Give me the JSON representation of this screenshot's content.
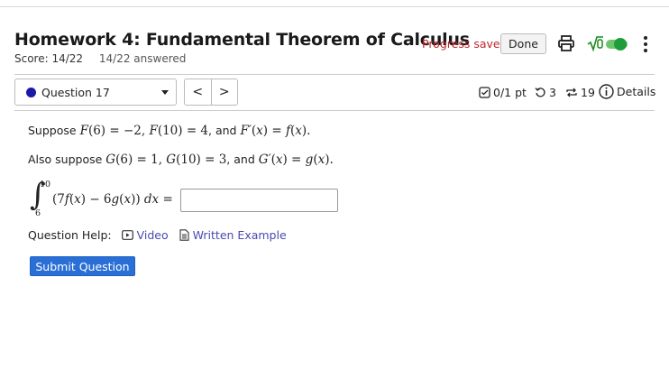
{
  "header": {
    "title": "Homework 4: Fundamental Theorem of Calculus",
    "score": "Score: 14/22",
    "answered": "14/22 answered",
    "progress_status": "Progress saved",
    "done_label": "Done"
  },
  "toolbar": {
    "question_select": "Question 17",
    "prev": "<",
    "next": ">",
    "points": "0/1 pt",
    "retries": "3",
    "attempts": "19",
    "details": "Details"
  },
  "problem": {
    "l1_a": "Suppose ",
    "l1_b": "F",
    "l1_c": "(6) = −2, ",
    "l1_d": "F",
    "l1_e": "(10) = 4",
    "l1_f": ", and ",
    "l1_g": "F′",
    "l1_h": "(",
    "l1_i": "x",
    "l1_j": ") = ",
    "l1_k": "f",
    "l1_l": "(",
    "l1_m": "x",
    "l1_n": ").",
    "l2_a": "Also suppose ",
    "l2_b": "G",
    "l2_c": "(6) = 1, ",
    "l2_d": "G",
    "l2_e": "(10) = 3",
    "l2_f": ", and ",
    "l2_g": "G′",
    "l2_h": "(",
    "l2_i": "x",
    "l2_j": ") = ",
    "l2_k": "g",
    "l2_l": "(",
    "l2_m": "x",
    "l2_n": ").",
    "int_upper": "10",
    "int_lower": "6",
    "int_sign": "∫",
    "int_a": "(7",
    "int_b": "f",
    "int_c": "(",
    "int_d": "x",
    "int_e": ") − 6",
    "int_f": "g",
    "int_g": "(",
    "int_h": "x",
    "int_i": ")) ",
    "int_j": "dx",
    "int_k": " =",
    "answer_value": ""
  },
  "help": {
    "label": "Question Help:",
    "video": "Video",
    "written": "Written Example"
  },
  "submit_label": "Submit Question"
}
